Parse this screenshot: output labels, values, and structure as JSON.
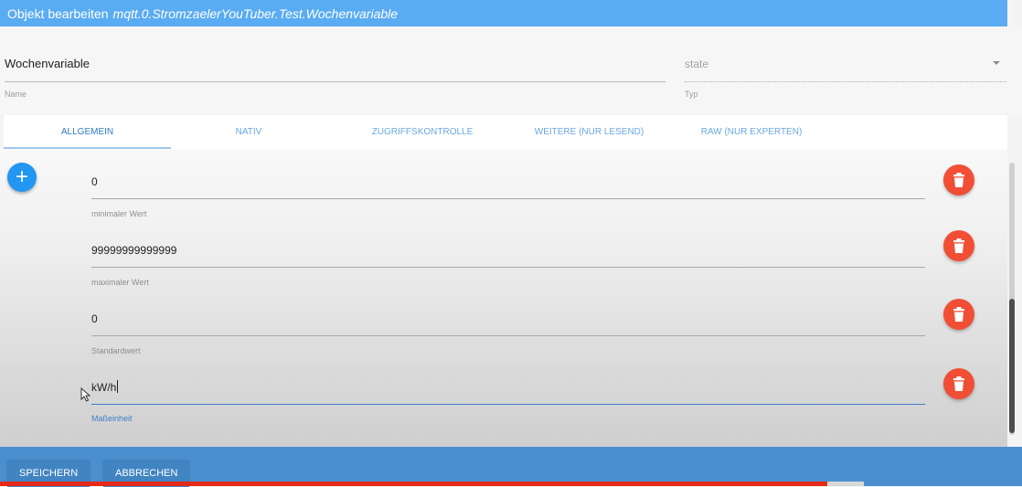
{
  "dialog": {
    "title_prefix": "Objekt bearbeiten",
    "object_id": "mqtt.0.StromzaelerYouTuber.Test.Wochenvariable"
  },
  "header": {
    "name_value": "Wochenvariable",
    "name_label": "Name",
    "type_value": "state",
    "type_label": "Typ"
  },
  "tabs": [
    {
      "label": "ALLGEMEIN",
      "active": true
    },
    {
      "label": "NATIV"
    },
    {
      "label": "ZUGRIFFSKONTROLLE"
    },
    {
      "label": "WEITERE (NUR LESEND)"
    },
    {
      "label": "RAW (NUR EXPERTEN)"
    }
  ],
  "fields": [
    {
      "value": "0",
      "label": "minimaler Wert"
    },
    {
      "value": "99999999999999",
      "label": "maximaler Wert"
    },
    {
      "value": "0",
      "label": "Standardwert"
    },
    {
      "value": "kW/h",
      "label": "Maßeinheit",
      "active": true
    }
  ],
  "buttons": {
    "save": "SPEICHERN",
    "cancel": "ABBRECHEN"
  },
  "colors": {
    "titlebar": "#5aacf2",
    "footer": "#4a90d0",
    "add_button": "#2196f3",
    "delete_button": "#f04f35",
    "active_tab": "#2f79c4"
  },
  "icons": {
    "add": "plus-icon",
    "delete": "trash-icon"
  }
}
